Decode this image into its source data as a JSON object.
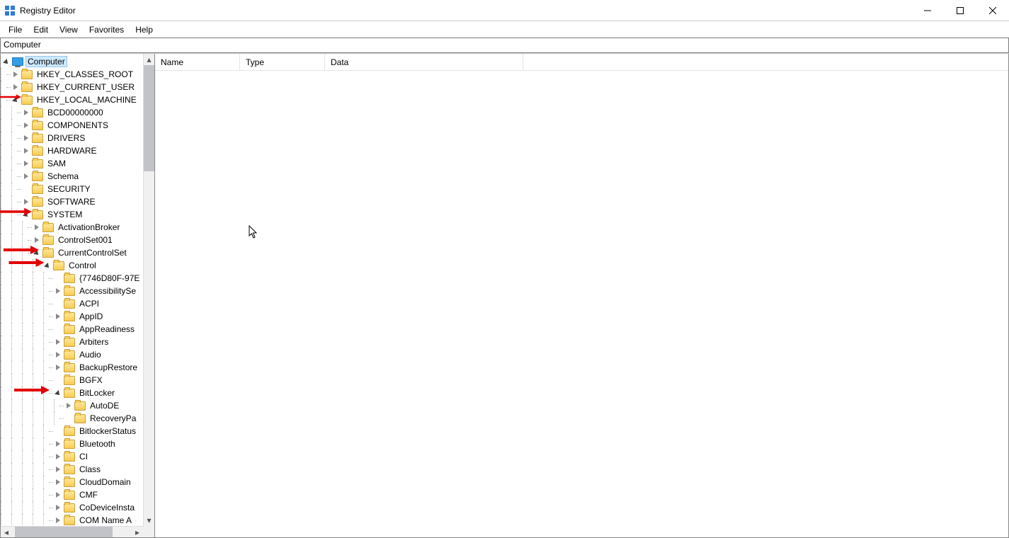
{
  "window": {
    "title": "Registry Editor"
  },
  "menu": {
    "file": "File",
    "edit": "Edit",
    "view": "View",
    "favorites": "Favorites",
    "help": "Help"
  },
  "address": "Computer",
  "columns": {
    "name": "Name",
    "type": "Type",
    "data": "Data"
  },
  "tree": {
    "root": "Computer",
    "hives": {
      "hkcr": "HKEY_CLASSES_ROOT",
      "hkcu": "HKEY_CURRENT_USER",
      "hklm": "HKEY_LOCAL_MACHINE"
    },
    "hklm_children": {
      "bcd": "BCD00000000",
      "components": "COMPONENTS",
      "drivers": "DRIVERS",
      "hardware": "HARDWARE",
      "sam": "SAM",
      "schema": "Schema",
      "security": "SECURITY",
      "software": "SOFTWARE",
      "system": "SYSTEM"
    },
    "system_children": {
      "activationbroker": "ActivationBroker",
      "controlset001": "ControlSet001",
      "currentcontrolset": "CurrentControlSet"
    },
    "ccs_children": {
      "control": "Control"
    },
    "control_children": {
      "guid": "{7746D80F-97E",
      "accessibility": "AccessibilitySe",
      "acpi": "ACPI",
      "appid": "AppID",
      "appreadiness": "AppReadiness",
      "arbiters": "Arbiters",
      "audio": "Audio",
      "backuprestore": "BackupRestore",
      "bgfx": "BGFX",
      "bitlocker": "BitLocker",
      "bitlockerstatus": "BitlockerStatus",
      "bluetooth": "Bluetooth",
      "ci": "CI",
      "class": "Class",
      "clouddomain": "CloudDomain",
      "cmf": "CMF",
      "codeviceinsta": "CoDeviceInsta",
      "comnamea": "COM Name A"
    },
    "bitlocker_children": {
      "autode": "AutoDE",
      "recoverypa": "RecoveryPa"
    }
  }
}
